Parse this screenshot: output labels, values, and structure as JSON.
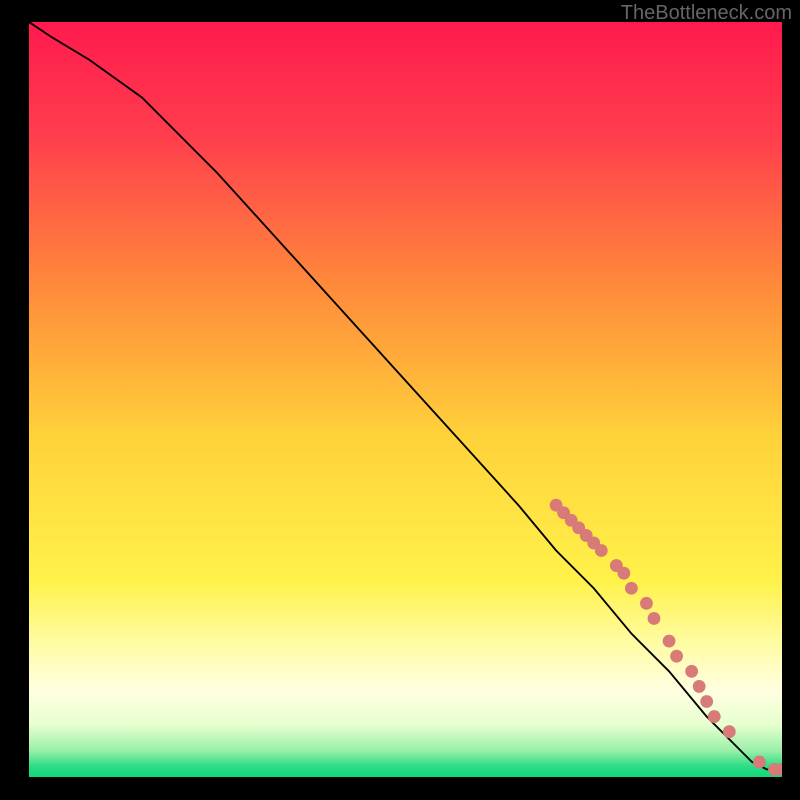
{
  "watermark": "TheBottleneck.com",
  "chart_data": {
    "type": "line",
    "title": "",
    "xlabel": "",
    "ylabel": "",
    "xlim": [
      0,
      100
    ],
    "ylim": [
      0,
      100
    ],
    "grid": false,
    "series": [
      {
        "name": "curve",
        "type": "line",
        "color": "#000000",
        "x": [
          0,
          3,
          8,
          15,
          25,
          35,
          45,
          55,
          65,
          70,
          75,
          80,
          85,
          90,
          93,
          96,
          98,
          100
        ],
        "y": [
          100,
          98,
          95,
          90,
          80,
          69,
          58,
          47,
          36,
          30,
          25,
          19,
          14,
          8,
          5,
          2,
          1,
          1
        ]
      },
      {
        "name": "markers",
        "type": "scatter",
        "color": "#d87a77",
        "x": [
          70,
          71,
          72,
          73,
          74,
          75,
          76,
          78,
          79,
          80,
          82,
          83,
          85,
          86,
          88,
          89,
          90,
          91,
          93,
          97,
          99,
          100
        ],
        "y": [
          36,
          35,
          34,
          33,
          32,
          31,
          30,
          28,
          27,
          25,
          23,
          21,
          18,
          16,
          14,
          12,
          10,
          8,
          6,
          2,
          1,
          1
        ]
      }
    ],
    "background_gradient": {
      "type": "vertical",
      "stops": [
        {
          "pos": 0.0,
          "color": "#ff1a4d"
        },
        {
          "pos": 0.15,
          "color": "#ff3d4d"
        },
        {
          "pos": 0.35,
          "color": "#ff8a3a"
        },
        {
          "pos": 0.55,
          "color": "#ffd23a"
        },
        {
          "pos": 0.74,
          "color": "#fff24a"
        },
        {
          "pos": 0.82,
          "color": "#fffba0"
        },
        {
          "pos": 0.885,
          "color": "#ffffe0"
        },
        {
          "pos": 0.93,
          "color": "#e8ffd0"
        },
        {
          "pos": 0.965,
          "color": "#9af0a8"
        },
        {
          "pos": 0.985,
          "color": "#30dd88"
        },
        {
          "pos": 1.0,
          "color": "#0fd878"
        }
      ]
    }
  }
}
